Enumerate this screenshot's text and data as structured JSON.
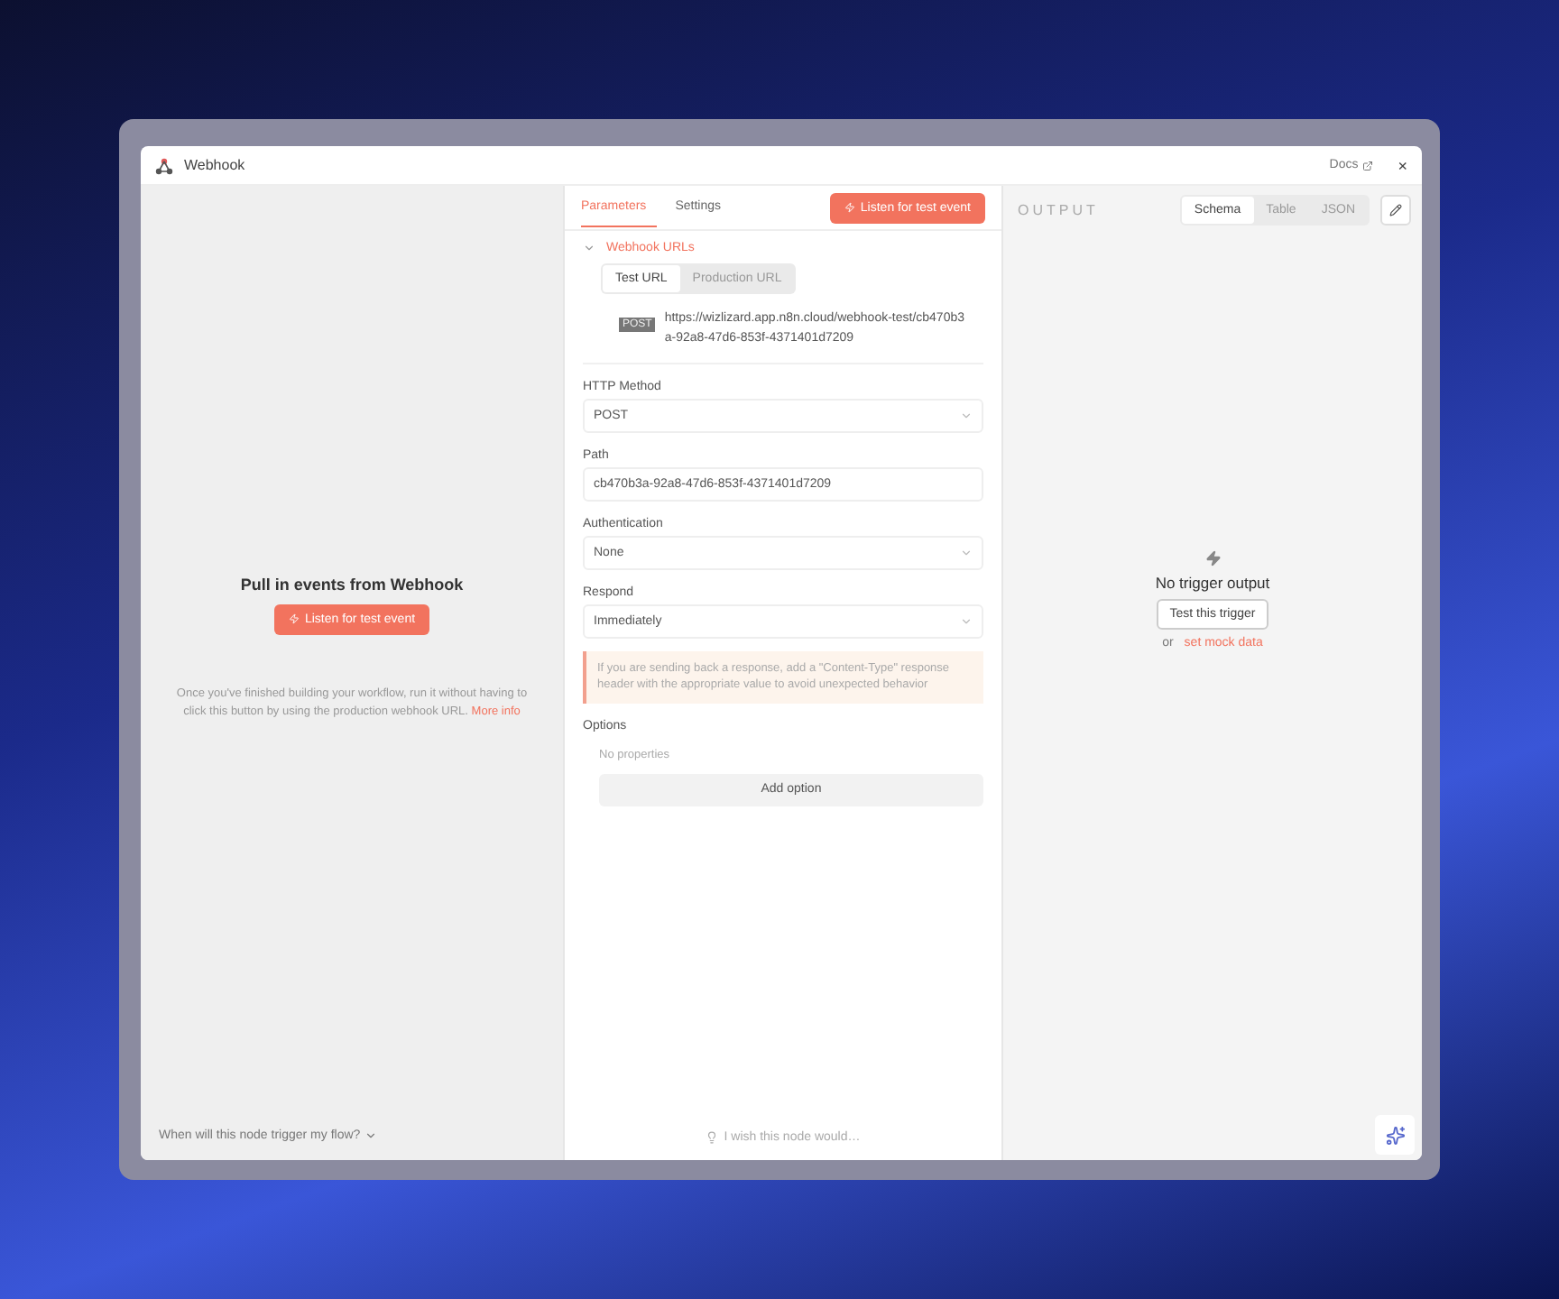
{
  "window": {
    "title": "Webhook",
    "docs_link": "Docs",
    "close": "×"
  },
  "input_panel": {
    "title": "Pull in events from Webhook",
    "button": "Listen for test event",
    "hint": "Once you've finished building your workflow, run it without having to click this button by using the production webhook URL.",
    "more_link": "More info",
    "footer_question": "When will this node trigger my flow?"
  },
  "tabs": [
    {
      "label": "Parameters",
      "selected": true
    },
    {
      "label": "Settings",
      "selected": false
    }
  ],
  "listen_button": "Listen for test event",
  "webhook_urls": {
    "title": "Webhook URLs",
    "expanded": true,
    "url_tabs": [
      {
        "label": "Test URL",
        "selected": true
      },
      {
        "label": "Production URL",
        "selected": false
      }
    ],
    "method_badge": "POST",
    "url": "https://wizlizard.app.n8n.cloud/webhook-test/cb470b3a-92a8-47d6-853f-4371401d7209"
  },
  "fields": [
    {
      "kind": "select",
      "label": "HTTP Method",
      "value": "POST"
    },
    {
      "kind": "text",
      "label": "Path",
      "value": "cb470b3a-92a8-47d6-853f-4371401d7209"
    },
    {
      "kind": "select",
      "label": "Authentication",
      "value": "None"
    },
    {
      "kind": "select",
      "label": "Respond",
      "value": "Immediately"
    }
  ],
  "notice": "If you are sending back a response, add a \"Content-Type\" response header with the appropriate value to avoid unexpected behavior",
  "options": {
    "label": "Options",
    "empty": "No properties",
    "add_button": "Add option"
  },
  "feedback": "I wish this node would…",
  "output_panel": {
    "title": "OUTPUT",
    "views": [
      {
        "label": "Schema",
        "selected": true
      },
      {
        "label": "Table",
        "selected": false
      },
      {
        "label": "JSON",
        "selected": false
      }
    ],
    "empty_title": "No trigger output",
    "test_button": "Test this trigger",
    "or_text": "or",
    "mock_link": "set mock data"
  }
}
